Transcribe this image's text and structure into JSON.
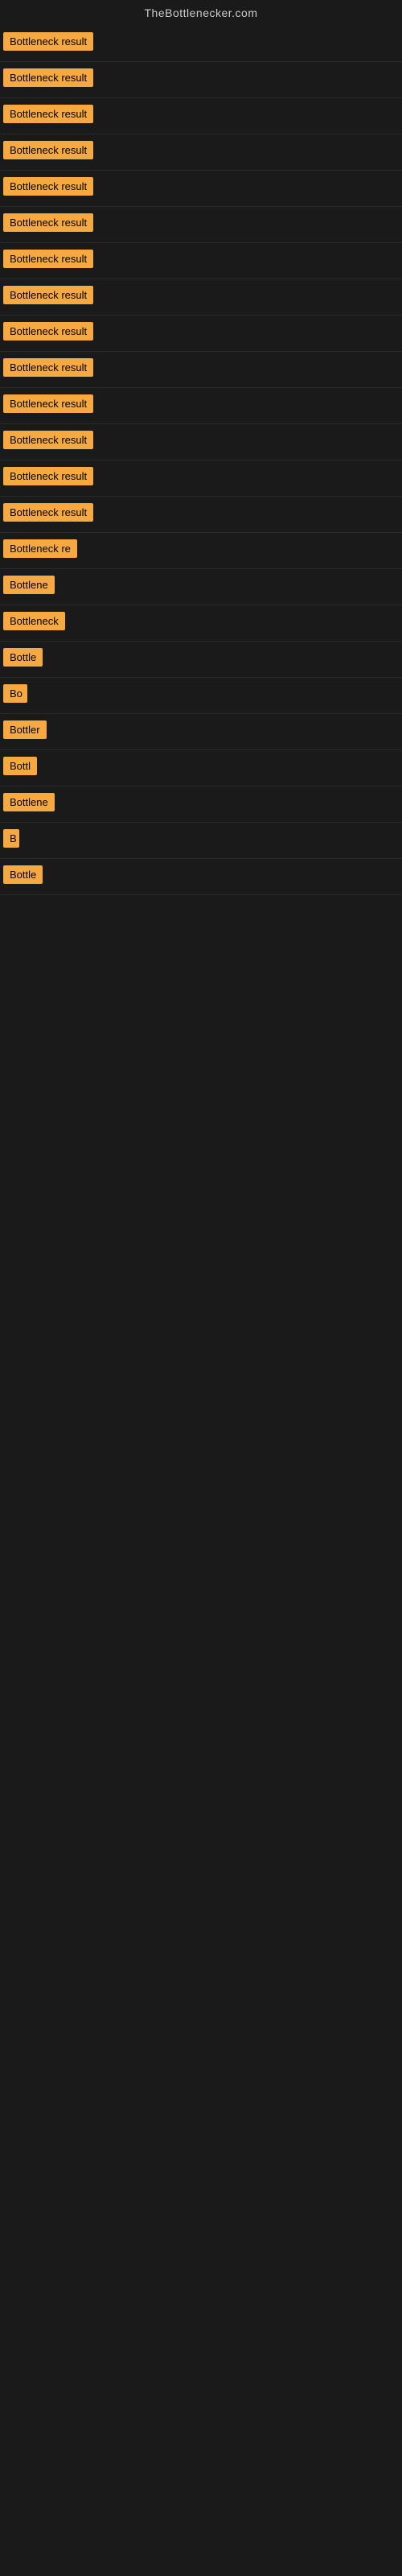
{
  "site": {
    "title": "TheBottlenecker.com"
  },
  "results": [
    {
      "id": 1,
      "label": "Bottleneck result",
      "width": 130
    },
    {
      "id": 2,
      "label": "Bottleneck result",
      "width": 130
    },
    {
      "id": 3,
      "label": "Bottleneck result",
      "width": 130
    },
    {
      "id": 4,
      "label": "Bottleneck result",
      "width": 130
    },
    {
      "id": 5,
      "label": "Bottleneck result",
      "width": 130
    },
    {
      "id": 6,
      "label": "Bottleneck result",
      "width": 130
    },
    {
      "id": 7,
      "label": "Bottleneck result",
      "width": 130
    },
    {
      "id": 8,
      "label": "Bottleneck result",
      "width": 130
    },
    {
      "id": 9,
      "label": "Bottleneck result",
      "width": 130
    },
    {
      "id": 10,
      "label": "Bottleneck result",
      "width": 130
    },
    {
      "id": 11,
      "label": "Bottleneck result",
      "width": 130
    },
    {
      "id": 12,
      "label": "Bottleneck result",
      "width": 130
    },
    {
      "id": 13,
      "label": "Bottleneck result",
      "width": 130
    },
    {
      "id": 14,
      "label": "Bottleneck result",
      "width": 125
    },
    {
      "id": 15,
      "label": "Bottleneck re",
      "width": 100
    },
    {
      "id": 16,
      "label": "Bottlene",
      "width": 80
    },
    {
      "id": 17,
      "label": "Bottleneck",
      "width": 85
    },
    {
      "id": 18,
      "label": "Bottle",
      "width": 65
    },
    {
      "id": 19,
      "label": "Bo",
      "width": 30
    },
    {
      "id": 20,
      "label": "Bottler",
      "width": 60
    },
    {
      "id": 21,
      "label": "Bottl",
      "width": 55
    },
    {
      "id": 22,
      "label": "Bottlene",
      "width": 78
    },
    {
      "id": 23,
      "label": "B",
      "width": 20
    },
    {
      "id": 24,
      "label": "Bottle",
      "width": 62
    }
  ],
  "colors": {
    "badge_bg": "#f5a940",
    "badge_text": "#000000",
    "site_title_text": "#cccccc",
    "background": "#1a1a1a"
  }
}
